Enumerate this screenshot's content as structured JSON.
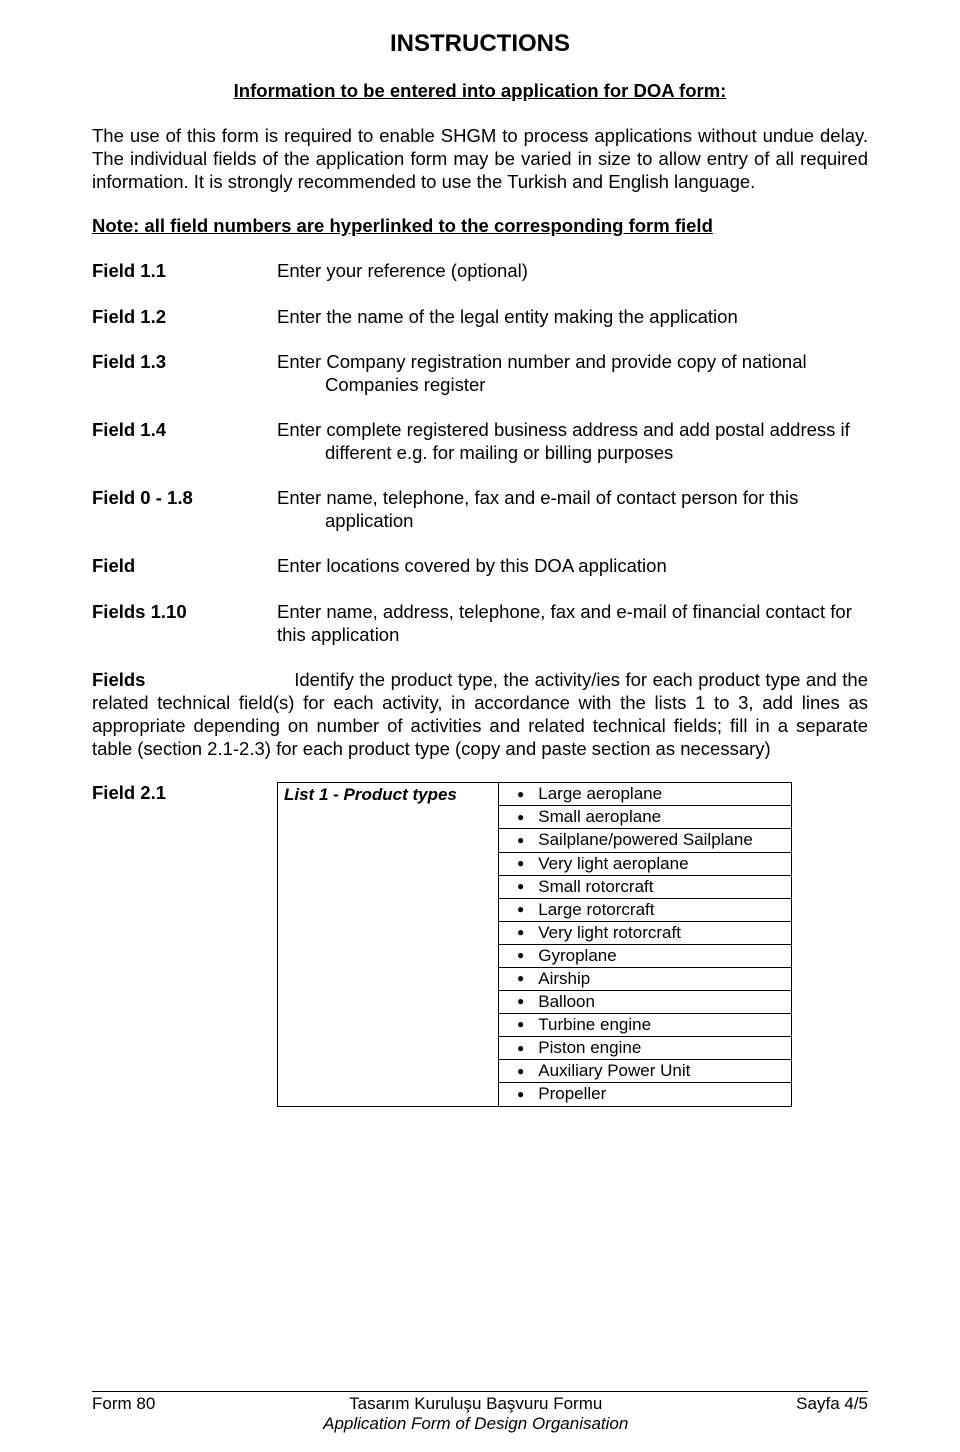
{
  "title": "INSTRUCTIONS",
  "subtitle": "Information to be entered into application for DOA form:",
  "intro": "The use of this form is required to enable SHGM to process applications without undue delay. The individual fields of the application form may be varied in size to allow entry of all required information. It is strongly recommended to use the Turkish and English language.",
  "note": "Note: all field numbers are hyperlinked to the corresponding form field",
  "fields": [
    {
      "label": "Field 1.1",
      "desc": "Enter your reference (optional)"
    },
    {
      "label": "Field 1.2",
      "desc": "Enter the name of the legal entity making the application"
    },
    {
      "label": "Field 1.3",
      "desc_line1": "Enter Company registration number and provide copy of national",
      "desc_line2": "Companies register"
    },
    {
      "label": "Field 1.4",
      "desc_line1": "Enter complete registered business address and add postal address if",
      "desc_line2": "different e.g. for mailing or billing purposes"
    },
    {
      "label": "Field 0 - 1.8",
      "desc_line1": "Enter name, telephone, fax and e-mail of contact person for this",
      "desc_line2": "application"
    },
    {
      "label": "Field",
      "desc": "Enter locations covered by this DOA application"
    },
    {
      "label": "Fields 1.10",
      "desc_twoline": "Enter name, address, telephone, fax and e-mail of financial contact for this application"
    }
  ],
  "fields_block_label": "Fields",
  "fields_block_text": "Identify the product type, the activity/ies for each product type and the related technical field(s) for each activity, in accordance with the lists 1 to 3, add lines as appropriate depending on number of activities and related technical fields; fill in a separate table (section 2.1-2.3) for each product type (copy and paste section as necessary)",
  "table": {
    "field_label": "Field 2.1",
    "header": "List 1 - Product types",
    "items": [
      "Large aeroplane",
      "Small aeroplane",
      "Sailplane/powered Sailplane",
      "Very light aeroplane",
      "Small rotorcraft",
      "Large rotorcraft",
      "Very light rotorcraft",
      "Gyroplane",
      "Airship",
      "Balloon",
      "Turbine engine",
      "Piston engine",
      "Auxiliary Power Unit",
      "Propeller"
    ]
  },
  "footer": {
    "left": "Form 80",
    "center1": "Tasarım Kuruluşu Başvuru Formu",
    "center2": "Application Form of Design Organisation",
    "right": "Sayfa 4/5"
  }
}
